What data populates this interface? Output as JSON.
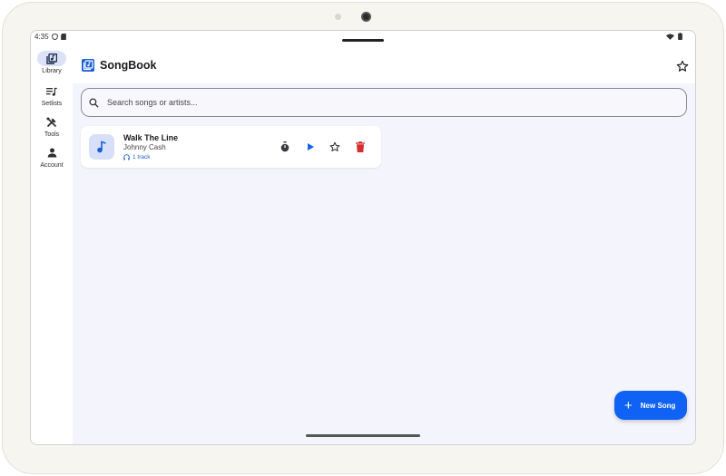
{
  "status_bar": {
    "time": "4:35"
  },
  "nav_rail": {
    "items": [
      {
        "label": "Library",
        "icon": "library-music-icon",
        "active": true
      },
      {
        "label": "Setlists",
        "icon": "queue-music-icon",
        "active": false
      },
      {
        "label": "Tools",
        "icon": "tools-icon",
        "active": false
      },
      {
        "label": "Account",
        "icon": "person-icon",
        "active": false
      }
    ]
  },
  "app_bar": {
    "title": "SongBook",
    "favorite_icon": "star-outline-icon"
  },
  "search": {
    "placeholder": "Search songs or artists..."
  },
  "songs": [
    {
      "title": "Walk The Line",
      "artist": "Johnny Cash",
      "tracks": "1 track",
      "actions": [
        "timer-icon",
        "play-icon",
        "star-outline-icon",
        "delete-icon"
      ]
    }
  ],
  "fab": {
    "label": "New Song",
    "icon": "plus-icon"
  },
  "colors": {
    "accent": "#1062f4",
    "delete": "#d32f2f",
    "rail_active": "#dbe2f7",
    "background": "#f4f4fc"
  }
}
